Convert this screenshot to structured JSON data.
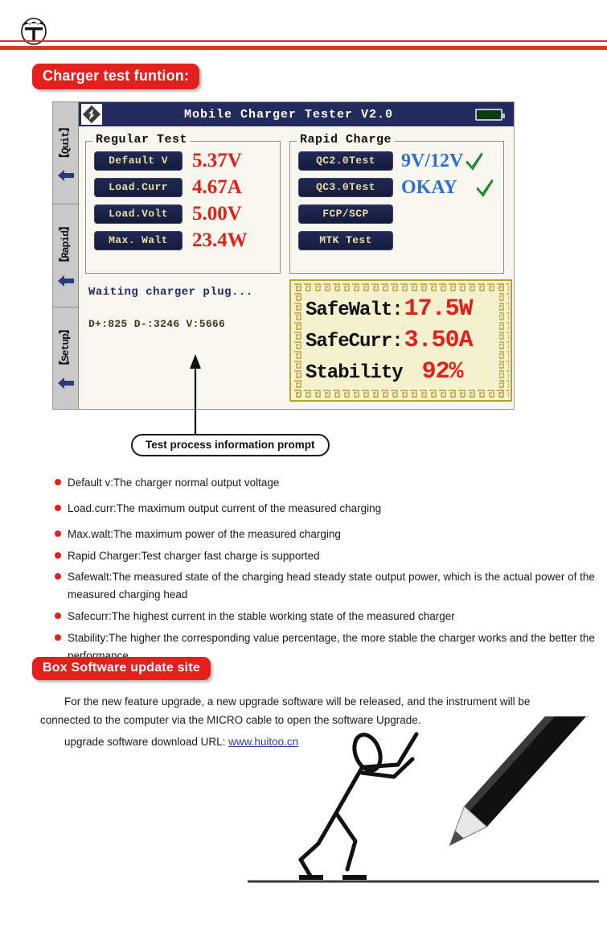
{
  "header": {
    "logo_icon": "company-crest-icon"
  },
  "badges": {
    "charger_test": "Charger test funtion:",
    "update_site": "Box Software update site"
  },
  "device": {
    "side_rail": [
      {
        "label": "【Quit】",
        "arrow_icon": "left-arrow-icon"
      },
      {
        "label": "【Rapid】",
        "arrow_icon": "left-arrow-icon"
      },
      {
        "label": "【Setup】",
        "arrow_icon": "left-arrow-icon"
      }
    ],
    "titlebar": {
      "logo_icon": "lightning-bolt-logo-icon",
      "title": "Mobile Charger Tester V2.0",
      "battery_icon": "battery-full-icon"
    },
    "regular_test": {
      "legend": "Regular Test",
      "rows": [
        {
          "button": "Default V",
          "value": "5.37V"
        },
        {
          "button": "Load.Curr",
          "value": "4.67A"
        },
        {
          "button": "Load.Volt",
          "value": "5.00V"
        },
        {
          "button": "Max. Walt",
          "value": "23.4W"
        }
      ]
    },
    "rapid_charge": {
      "legend": "Rapid Charge",
      "rows": [
        {
          "button": "QC2.0Test",
          "value": "9V/12V",
          "check_icon": "green-check-icon"
        },
        {
          "button": "QC3.0Test",
          "value": "OKAY",
          "check_icon": "green-check-icon"
        },
        {
          "button": "FCP/SCP",
          "value": "",
          "check_icon": ""
        },
        {
          "button": "MTK Test",
          "value": "",
          "check_icon": ""
        }
      ]
    },
    "status": {
      "line1": "Waiting charger plug...",
      "line2": "D+:825 D-:3246 V:5666"
    },
    "safe_panel": {
      "rows": [
        {
          "label": "SafeWalt:",
          "value": "17.5W"
        },
        {
          "label": "SafeCurr:",
          "value": "3.50A"
        },
        {
          "label": "Stability",
          "value": "92%"
        }
      ]
    }
  },
  "callout": {
    "label": "Test process information prompt",
    "arrow_icon": "up-arrow-icon"
  },
  "bullets": [
    "Default v:The charger normal output voltage",
    "Load.curr:The maximum output current of the measured charging",
    "Max.walt:The maximum power of the measured charging",
    "Rapid Charger:Test charger fast charge is supported",
    "Safewalt:The measured state of the charging head steady state output power, which is the actual power of the measured charging head",
    "Safecurr:The highest current in the stable working state of the measured charger",
    "Stability:The higher the corresponding value percentage, the more stable the charger works and the better the performance.。"
  ],
  "update": {
    "paragraph": "For the new feature upgrade, a new upgrade software will be released, and the instrument will be connected to the computer via the MICRO cable to open the software Upgrade.",
    "download_label": "upgrade software download URL:",
    "download_url": "www.huitoo.cn"
  },
  "illustration": {
    "name": "stick-figure-pushing-pencil-illustration"
  },
  "colors": {
    "red": "#e2211c",
    "rule_red": "#d8392f",
    "navy": "#222a5e",
    "lcd_text": "#ecdca0",
    "value_red": "#e1201a",
    "value_blue": "#2f6fd0",
    "safe_bg": "#f5f0cd",
    "safe_border": "#b8a13a",
    "link_blue": "#2a3f9c"
  }
}
